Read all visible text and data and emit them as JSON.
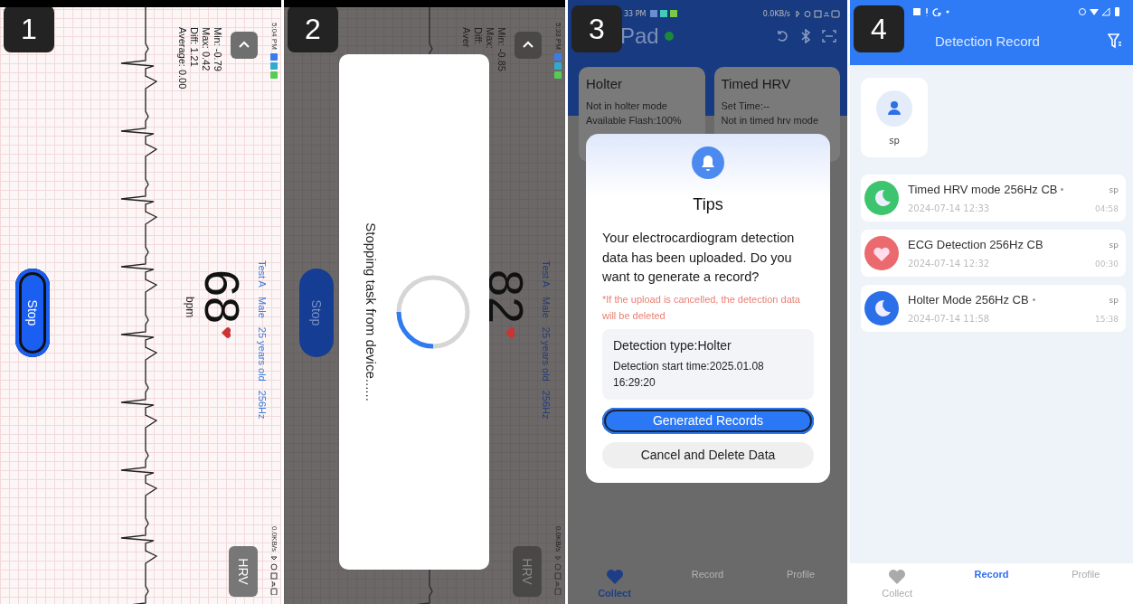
{
  "panels": [
    {
      "kind": "ecg_landscape",
      "badge": "1",
      "dimmed": false,
      "status_time": "5:04 PM",
      "status_speed": "0.0KB/s",
      "patient_info": [
        "Test A",
        "Male",
        "25 years old",
        "256Hz"
      ],
      "stats": [
        "Min: -0.79",
        "Max: 0.42",
        "Diff: 1.21",
        "Average: 0.00"
      ],
      "heart_rate": "68",
      "heart_rate_unit": "bpm",
      "hrv_button": "HRV",
      "stop_button": {
        "label": "Stop",
        "focused": true
      }
    },
    {
      "kind": "ecg_landscape",
      "badge": "2",
      "dimmed": true,
      "status_time": "5:33 PM",
      "status_speed": "0.0KB/s",
      "patient_info": [
        "Test A",
        "Male",
        "25 years old",
        "256Hz"
      ],
      "stats": [
        "Min: -0.85",
        "Max:",
        "Diff:",
        "Aver"
      ],
      "heart_rate": "82",
      "hrv_button": "HRV",
      "stop_button": {
        "label": "Stop",
        "focused": false
      },
      "dialog": {
        "message": "Stopping task from device......"
      }
    },
    {
      "kind": "tips_dialog",
      "badge": "3",
      "status_time": "33 PM",
      "status_speed": "0.0KB/s",
      "app_title": "Pad",
      "cards": [
        {
          "title": "Holter",
          "lines": [
            "Not in holter mode",
            "Available Flash:100%"
          ]
        },
        {
          "title": "Timed HRV",
          "lines": [
            "Set Time:--",
            "Not in timed hrv mode"
          ]
        }
      ],
      "dialog": {
        "title": "Tips",
        "message": "Your electrocardiogram detection data has been uploaded. Do you want to generate a record?",
        "warning": "*If the upload is cancelled, the detection data will be deleted",
        "detection_type": "Detection type:Holter",
        "start_time": "Detection start time:2025.01.08 16:29:20",
        "buttons": [
          {
            "label": "Generated Records",
            "kind": "primary",
            "focused": true
          },
          {
            "label": "Cancel and Delete Data",
            "kind": "secondary",
            "focused": false
          }
        ]
      },
      "tabs": [
        {
          "label": "Collect",
          "selected": true
        },
        {
          "label": "Record",
          "selected": false
        },
        {
          "label": "Profile",
          "selected": false
        }
      ]
    },
    {
      "kind": "record_list",
      "badge": "4",
      "title": "Detection Record",
      "profile": {
        "name": "sp"
      },
      "records": [
        {
          "title": "Timed HRV mode 256Hz CB",
          "marked": true,
          "user": "sp",
          "date": "2024-07-14 12:33",
          "duration": "04:58",
          "color": "#3cc46e",
          "kind": "sleep"
        },
        {
          "title": "ECG Detection 256Hz CB",
          "marked": false,
          "user": "sp",
          "date": "2024-07-14 12:32",
          "duration": "00:30",
          "color": "#ea6a6d",
          "kind": "ecg"
        },
        {
          "title": "Holter Mode 256Hz CB",
          "marked": true,
          "user": "sp",
          "date": "2024-07-14 11:58",
          "duration": "15:38",
          "color": "#2b70e8",
          "kind": "sleep"
        }
      ],
      "tabs": [
        {
          "label": "Collect",
          "selected": false
        },
        {
          "label": "Record",
          "selected": true
        },
        {
          "label": "Profile",
          "selected": false
        }
      ]
    }
  ]
}
